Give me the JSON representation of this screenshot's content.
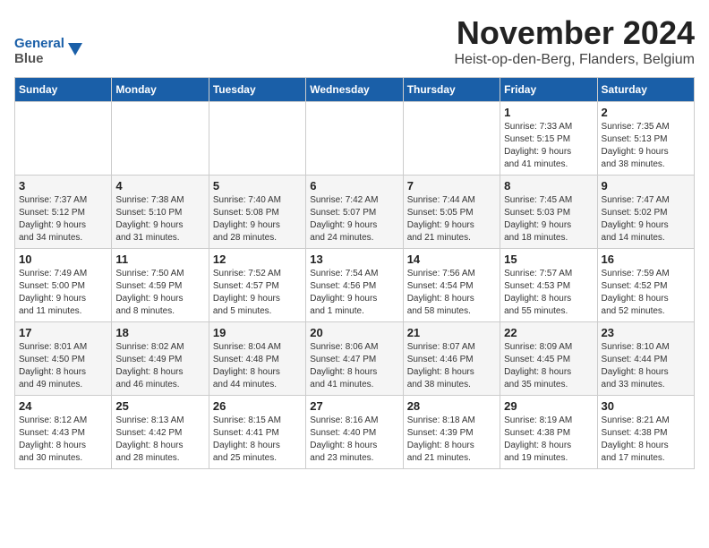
{
  "logo": {
    "line1": "General",
    "line2": "Blue"
  },
  "header": {
    "month": "November 2024",
    "location": "Heist-op-den-Berg, Flanders, Belgium"
  },
  "days_of_week": [
    "Sunday",
    "Monday",
    "Tuesday",
    "Wednesday",
    "Thursday",
    "Friday",
    "Saturday"
  ],
  "weeks": [
    [
      {
        "day": "",
        "info": ""
      },
      {
        "day": "",
        "info": ""
      },
      {
        "day": "",
        "info": ""
      },
      {
        "day": "",
        "info": ""
      },
      {
        "day": "",
        "info": ""
      },
      {
        "day": "1",
        "info": "Sunrise: 7:33 AM\nSunset: 5:15 PM\nDaylight: 9 hours\nand 41 minutes."
      },
      {
        "day": "2",
        "info": "Sunrise: 7:35 AM\nSunset: 5:13 PM\nDaylight: 9 hours\nand 38 minutes."
      }
    ],
    [
      {
        "day": "3",
        "info": "Sunrise: 7:37 AM\nSunset: 5:12 PM\nDaylight: 9 hours\nand 34 minutes."
      },
      {
        "day": "4",
        "info": "Sunrise: 7:38 AM\nSunset: 5:10 PM\nDaylight: 9 hours\nand 31 minutes."
      },
      {
        "day": "5",
        "info": "Sunrise: 7:40 AM\nSunset: 5:08 PM\nDaylight: 9 hours\nand 28 minutes."
      },
      {
        "day": "6",
        "info": "Sunrise: 7:42 AM\nSunset: 5:07 PM\nDaylight: 9 hours\nand 24 minutes."
      },
      {
        "day": "7",
        "info": "Sunrise: 7:44 AM\nSunset: 5:05 PM\nDaylight: 9 hours\nand 21 minutes."
      },
      {
        "day": "8",
        "info": "Sunrise: 7:45 AM\nSunset: 5:03 PM\nDaylight: 9 hours\nand 18 minutes."
      },
      {
        "day": "9",
        "info": "Sunrise: 7:47 AM\nSunset: 5:02 PM\nDaylight: 9 hours\nand 14 minutes."
      }
    ],
    [
      {
        "day": "10",
        "info": "Sunrise: 7:49 AM\nSunset: 5:00 PM\nDaylight: 9 hours\nand 11 minutes."
      },
      {
        "day": "11",
        "info": "Sunrise: 7:50 AM\nSunset: 4:59 PM\nDaylight: 9 hours\nand 8 minutes."
      },
      {
        "day": "12",
        "info": "Sunrise: 7:52 AM\nSunset: 4:57 PM\nDaylight: 9 hours\nand 5 minutes."
      },
      {
        "day": "13",
        "info": "Sunrise: 7:54 AM\nSunset: 4:56 PM\nDaylight: 9 hours\nand 1 minute."
      },
      {
        "day": "14",
        "info": "Sunrise: 7:56 AM\nSunset: 4:54 PM\nDaylight: 8 hours\nand 58 minutes."
      },
      {
        "day": "15",
        "info": "Sunrise: 7:57 AM\nSunset: 4:53 PM\nDaylight: 8 hours\nand 55 minutes."
      },
      {
        "day": "16",
        "info": "Sunrise: 7:59 AM\nSunset: 4:52 PM\nDaylight: 8 hours\nand 52 minutes."
      }
    ],
    [
      {
        "day": "17",
        "info": "Sunrise: 8:01 AM\nSunset: 4:50 PM\nDaylight: 8 hours\nand 49 minutes."
      },
      {
        "day": "18",
        "info": "Sunrise: 8:02 AM\nSunset: 4:49 PM\nDaylight: 8 hours\nand 46 minutes."
      },
      {
        "day": "19",
        "info": "Sunrise: 8:04 AM\nSunset: 4:48 PM\nDaylight: 8 hours\nand 44 minutes."
      },
      {
        "day": "20",
        "info": "Sunrise: 8:06 AM\nSunset: 4:47 PM\nDaylight: 8 hours\nand 41 minutes."
      },
      {
        "day": "21",
        "info": "Sunrise: 8:07 AM\nSunset: 4:46 PM\nDaylight: 8 hours\nand 38 minutes."
      },
      {
        "day": "22",
        "info": "Sunrise: 8:09 AM\nSunset: 4:45 PM\nDaylight: 8 hours\nand 35 minutes."
      },
      {
        "day": "23",
        "info": "Sunrise: 8:10 AM\nSunset: 4:44 PM\nDaylight: 8 hours\nand 33 minutes."
      }
    ],
    [
      {
        "day": "24",
        "info": "Sunrise: 8:12 AM\nSunset: 4:43 PM\nDaylight: 8 hours\nand 30 minutes."
      },
      {
        "day": "25",
        "info": "Sunrise: 8:13 AM\nSunset: 4:42 PM\nDaylight: 8 hours\nand 28 minutes."
      },
      {
        "day": "26",
        "info": "Sunrise: 8:15 AM\nSunset: 4:41 PM\nDaylight: 8 hours\nand 25 minutes."
      },
      {
        "day": "27",
        "info": "Sunrise: 8:16 AM\nSunset: 4:40 PM\nDaylight: 8 hours\nand 23 minutes."
      },
      {
        "day": "28",
        "info": "Sunrise: 8:18 AM\nSunset: 4:39 PM\nDaylight: 8 hours\nand 21 minutes."
      },
      {
        "day": "29",
        "info": "Sunrise: 8:19 AM\nSunset: 4:38 PM\nDaylight: 8 hours\nand 19 minutes."
      },
      {
        "day": "30",
        "info": "Sunrise: 8:21 AM\nSunset: 4:38 PM\nDaylight: 8 hours\nand 17 minutes."
      }
    ]
  ]
}
